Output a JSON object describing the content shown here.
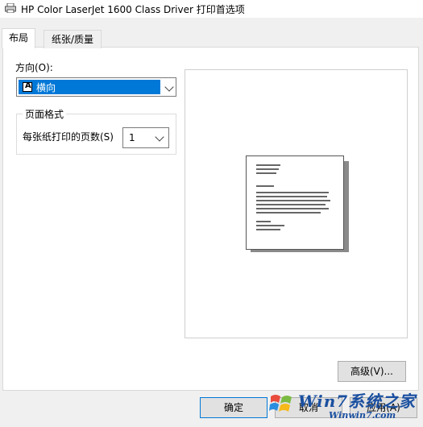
{
  "window": {
    "title": "HP Color LaserJet 1600 Class Driver 打印首选项"
  },
  "tabs": [
    {
      "label": "布局",
      "active": true
    },
    {
      "label": "纸张/质量",
      "active": false
    }
  ],
  "layout": {
    "orientation_label": "方向(O):",
    "orientation_value": "横向",
    "orientation_icon": "A",
    "page_format_group": "页面格式",
    "pages_per_sheet_label": "每张纸打印的页数(S)",
    "pages_per_sheet_value": "1"
  },
  "buttons": {
    "advanced": "高级(V)...",
    "ok": "确定",
    "cancel": "取消",
    "apply": "应用(A)"
  },
  "watermark": {
    "brand": "Win7系统之家",
    "url": "Winwin7.com"
  },
  "colors": {
    "selection": "#0078d7",
    "dialog_bg": "#f0f0f0"
  }
}
